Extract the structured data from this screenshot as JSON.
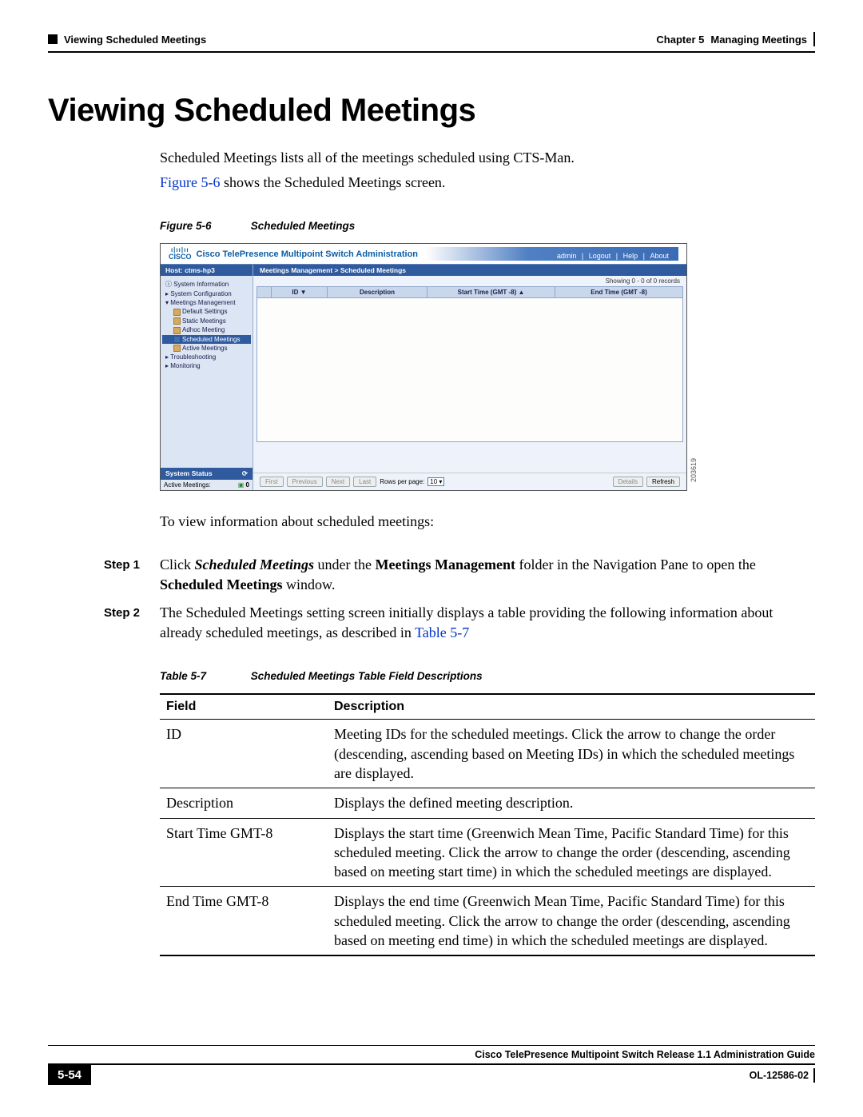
{
  "header": {
    "chapter": "Chapter 5",
    "chapter_title": "Managing Meetings",
    "section": "Viewing Scheduled Meetings"
  },
  "title": "Viewing Scheduled Meetings",
  "intro": {
    "p1": "Scheduled Meetings lists all of the meetings scheduled using CTS-Man.",
    "p2a": "Figure 5-6",
    "p2b": " shows the Scheduled Meetings screen."
  },
  "figure": {
    "label": "Figure 5-6",
    "title": "Scheduled Meetings"
  },
  "screenshot": {
    "logo_top": "ı|ıı|ıı",
    "logo_bottom": "CISCO",
    "app_title": "Cisco TelePresence Multipoint Switch Administration",
    "links": {
      "user": "admin",
      "logout": "Logout",
      "help": "Help",
      "about": "About"
    },
    "host_label": "Host: ctms-hp3",
    "nav": {
      "sys_info": "System Information",
      "sys_conf": "System Configuration",
      "mtg_mgmt": "Meetings Management",
      "default_settings": "Default Settings",
      "static_mtg": "Static Meetings",
      "adhoc_mtg": "Adhoc Meeting",
      "sched_mtg": "Scheduled Meetings",
      "active_mtg": "Active Meetings",
      "trouble": "Troubleshooting",
      "monitor": "Monitoring"
    },
    "status": {
      "title": "System Status",
      "active_label": "Active Meetings:",
      "active_val": "0"
    },
    "breadcrumb": "Meetings Management > Scheduled Meetings",
    "records": "Showing 0 - 0 of 0 records",
    "cols": {
      "id": "ID ▼",
      "desc": "Description",
      "start": "Start Time (GMT -8) ▲",
      "end": "End Time (GMT -8)"
    },
    "footer": {
      "first": "First",
      "prev": "Previous",
      "next": "Next",
      "last": "Last",
      "rpp": "Rows per page:",
      "rpp_val": "10",
      "details": "Details",
      "refresh": "Refresh"
    },
    "img_id": "203619"
  },
  "after_figure": "To view information about scheduled meetings:",
  "steps": {
    "s1_label": "Step 1",
    "s1_a": "Click ",
    "s1_b": "Scheduled Meetings",
    "s1_c": " under the ",
    "s1_d": "Meetings Management",
    "s1_e": " folder in the Navigation Pane to open the ",
    "s1_f": "Scheduled Meetings",
    "s1_g": " window.",
    "s2_label": "Step 2",
    "s2_a": "The Scheduled Meetings setting screen initially displays a table providing the following information about already scheduled meetings, as described in ",
    "s2_b": "Table 5-7"
  },
  "table_caption": {
    "label": "Table 5-7",
    "title": "Scheduled Meetings Table Field Descriptions"
  },
  "table": {
    "h1": "Field",
    "h2": "Description",
    "rows": [
      {
        "f": "ID",
        "d": "Meeting IDs for the scheduled meetings. Click the arrow to change the order (descending, ascending based on Meeting IDs) in which the scheduled meetings are displayed."
      },
      {
        "f": "Description",
        "d": "Displays the defined meeting description."
      },
      {
        "f": "Start Time GMT-8",
        "d": "Displays the start time (Greenwich Mean Time, Pacific Standard Time) for this scheduled meeting. Click the arrow to change the order (descending, ascending based on meeting start time) in which the scheduled meetings are displayed."
      },
      {
        "f": "End Time GMT-8",
        "d": "Displays the end time (Greenwich Mean Time, Pacific Standard Time) for this scheduled meeting. Click the arrow to change the order (descending, ascending based on meeting end time) in which the scheduled meetings are displayed."
      }
    ]
  },
  "footer": {
    "guide": "Cisco TelePresence Multipoint Switch Release 1.1 Administration Guide",
    "page": "5-54",
    "doc_id": "OL-12586-02"
  }
}
